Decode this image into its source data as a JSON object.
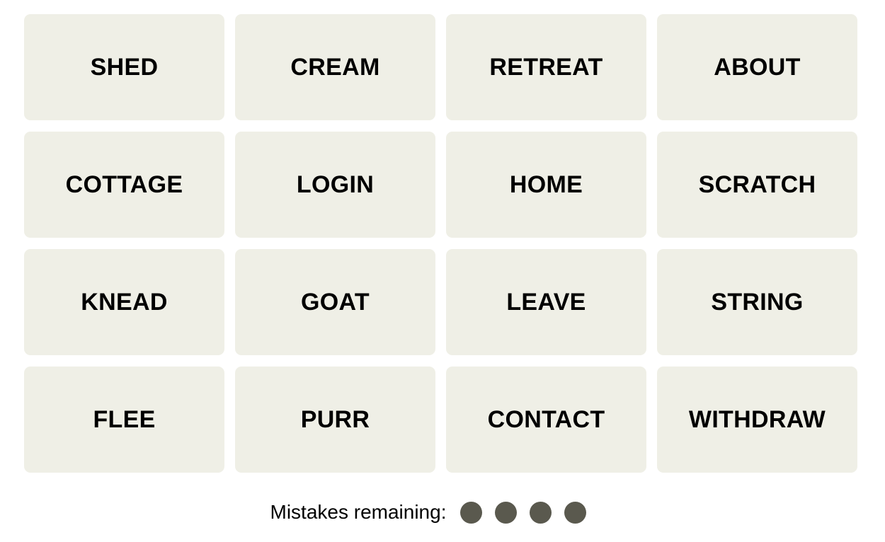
{
  "tiles": [
    "SHED",
    "CREAM",
    "RETREAT",
    "ABOUT",
    "COTTAGE",
    "LOGIN",
    "HOME",
    "SCRATCH",
    "KNEAD",
    "GOAT",
    "LEAVE",
    "STRING",
    "FLEE",
    "PURR",
    "CONTACT",
    "WITHDRAW"
  ],
  "mistakes": {
    "label": "Mistakes remaining:",
    "remaining": 4,
    "dot_color": "#5a594e"
  },
  "colors": {
    "tile_bg": "#efefe6"
  }
}
